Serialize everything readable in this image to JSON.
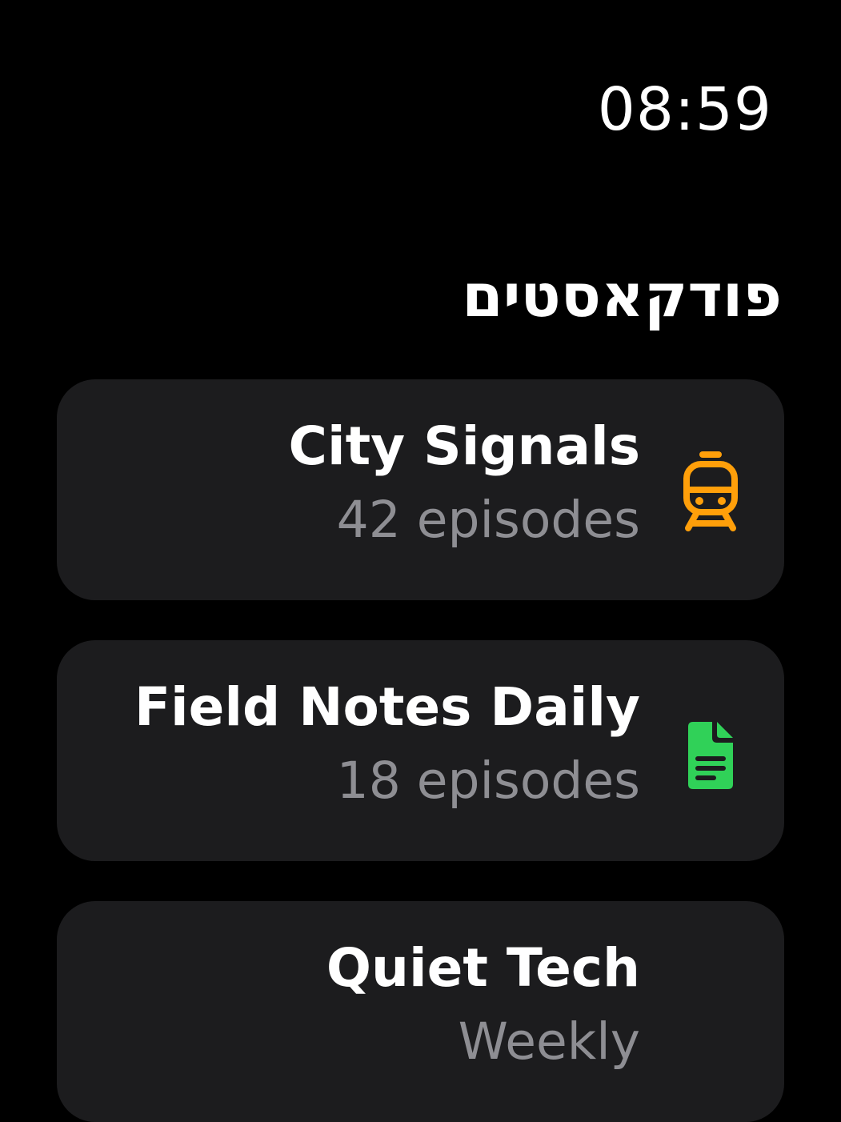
{
  "status": {
    "time": "08:59"
  },
  "header": {
    "title": "פודקאסטים"
  },
  "podcasts": [
    {
      "title": "City Signals",
      "subtitle": "42 episodes",
      "icon": "tram-icon",
      "color": "#ff9f0a"
    },
    {
      "title": "Field Notes Daily",
      "subtitle": "18 episodes",
      "icon": "document-icon",
      "color": "#30d158"
    },
    {
      "title": "Quiet Tech",
      "subtitle": "Weekly",
      "icon": "link-icon",
      "color": "#0a84ff"
    }
  ]
}
